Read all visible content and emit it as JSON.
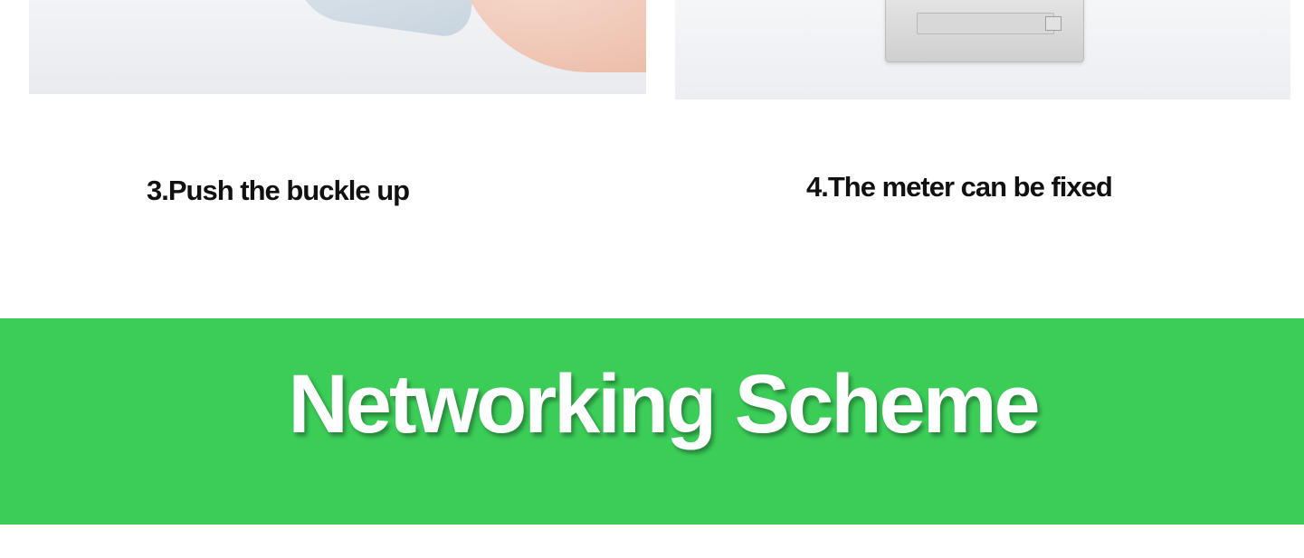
{
  "steps": [
    {
      "label": "3.Push the buckle up"
    },
    {
      "label": "4.The meter can be fixed"
    }
  ],
  "banner": {
    "title": "Networking Scheme",
    "color": "#3ccd58",
    "text_color": "#ffffff"
  }
}
